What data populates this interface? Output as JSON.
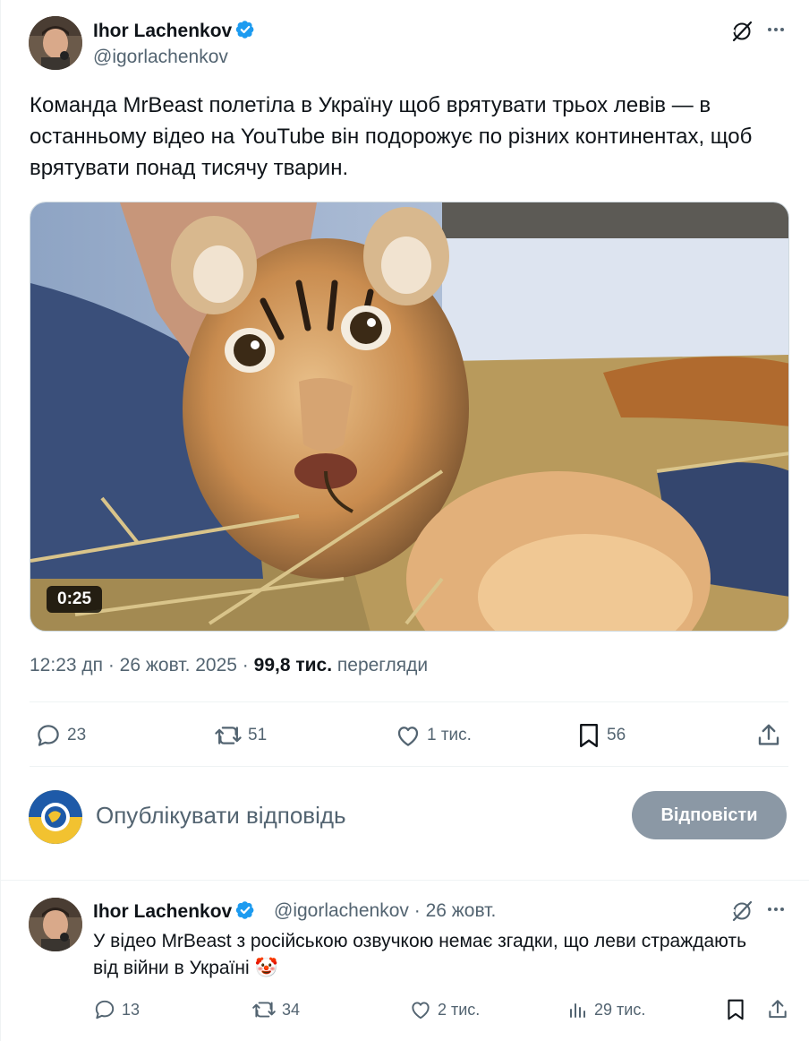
{
  "tweet": {
    "author_name": "Ihor Lachenkov",
    "author_handle": "@igorlachenkov",
    "text": "Команда MrBeast полетіла в Україну щоб врятувати трьох левів — в останньому відео на YouTube він подорожує по різних континентах, щоб врятувати понад тисячу тварин.",
    "video_duration": "0:25",
    "timestamp": "12:23 дп · 26 жовт. 2025 · ",
    "views_count": "99,8 тис.",
    "views_label": " перегляди",
    "stats": {
      "replies": "23",
      "reposts": "51",
      "likes": "1 тис.",
      "bookmarks": "56"
    }
  },
  "reply_composer": {
    "placeholder": "Опублікувати відповідь",
    "button_label": "Відповісти"
  },
  "reply": {
    "author_name": "Ihor Lachenkov",
    "author_handle": "@igorlachenkov",
    "date": " · 26 жовт.",
    "text": "У відео MrBeast з російською озвучкою немає згадки, що леви страждають від війни в Україні 🤡",
    "stats": {
      "replies": "13",
      "reposts": "34",
      "likes": "2 тис.",
      "views": "29 тис."
    }
  },
  "colors": {
    "verified": "#1d9bf0",
    "secondary_text": "#536471",
    "reply_button": "#8b98a5"
  }
}
